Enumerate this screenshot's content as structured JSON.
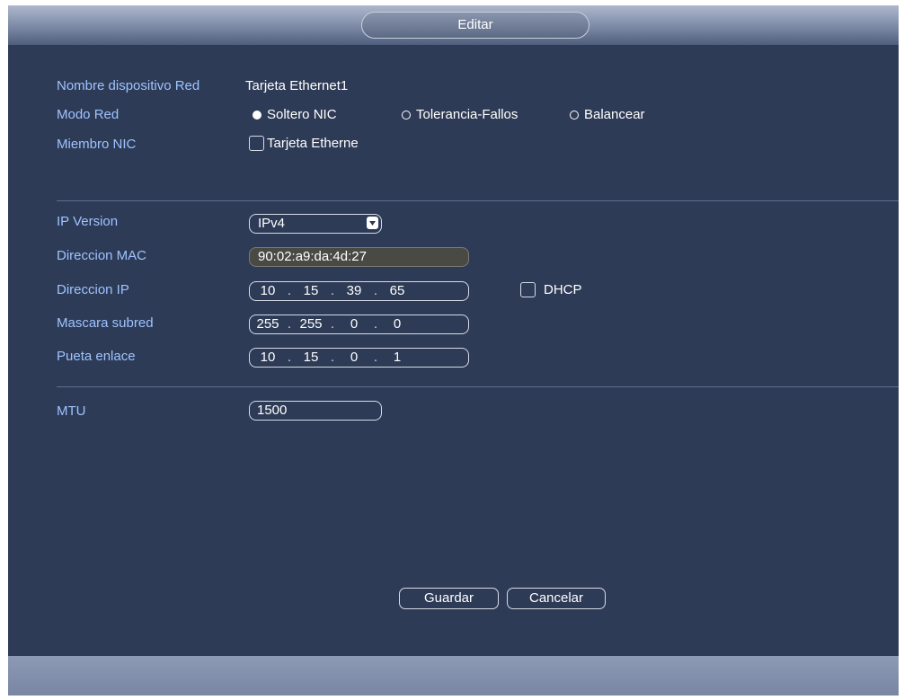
{
  "dialog": {
    "title": "Editar"
  },
  "device": {
    "label": "Nombre dispositivo Red",
    "value": "Tarjeta Ethernet1"
  },
  "mode": {
    "label": "Modo Red",
    "options": [
      "Soltero NIC",
      "Tolerancia-Fallos",
      "Balancear"
    ],
    "selected": "Soltero NIC"
  },
  "member": {
    "label": "Miembro NIC",
    "option": "Tarjeta Etherne",
    "checked": false
  },
  "ipversion": {
    "label": "IP Version",
    "value": "IPv4"
  },
  "mac": {
    "label": "Direccion MAC",
    "value": "90:02:a9:da:4d:27"
  },
  "ip": {
    "label": "Direccion IP",
    "octets": [
      "10",
      "15",
      "39",
      "65"
    ]
  },
  "dhcp": {
    "label": "DHCP",
    "checked": false
  },
  "mask": {
    "label": "Mascara subred",
    "octets": [
      "255",
      "255",
      "0",
      "0"
    ]
  },
  "gateway": {
    "label": "Pueta enlace",
    "octets": [
      "10",
      "15",
      "0",
      "1"
    ]
  },
  "mtu": {
    "label": "MTU",
    "value": "1500"
  },
  "buttons": {
    "save": "Guardar",
    "cancel": "Cancelar"
  },
  "ip_separator": "."
}
